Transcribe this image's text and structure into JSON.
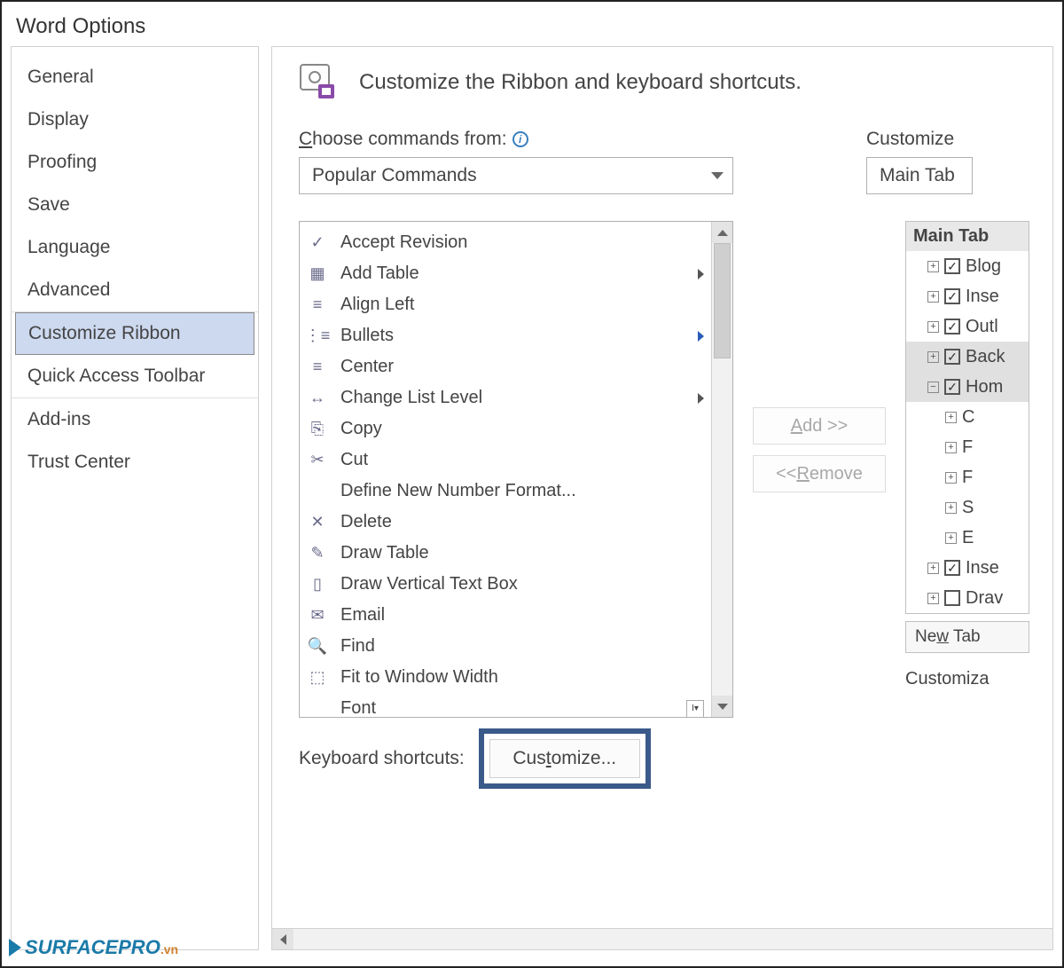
{
  "title": "Word Options",
  "sidebar": {
    "items": [
      {
        "label": "General"
      },
      {
        "label": "Display"
      },
      {
        "label": "Proofing"
      },
      {
        "label": "Save"
      },
      {
        "label": "Language"
      },
      {
        "label": "Advanced"
      },
      {
        "label": "Customize Ribbon"
      },
      {
        "label": "Quick Access Toolbar"
      },
      {
        "label": "Add-ins"
      },
      {
        "label": "Trust Center"
      }
    ]
  },
  "header": {
    "text": "Customize the Ribbon and keyboard shortcuts."
  },
  "choose_label": "Choose commands from:",
  "choose_value": "Popular Commands",
  "customize_ribbon_label": "Customize",
  "customize_ribbon_value": "Main Tab",
  "commands": [
    {
      "label": "Accept Revision",
      "icon": "✓",
      "sub": false
    },
    {
      "label": "Add Table",
      "icon": "▦",
      "sub": true
    },
    {
      "label": "Align Left",
      "icon": "≡",
      "sub": false
    },
    {
      "label": "Bullets",
      "icon": "⋮≡",
      "sub": true,
      "blue": true
    },
    {
      "label": "Center",
      "icon": "≡",
      "sub": false
    },
    {
      "label": "Change List Level",
      "icon": "↔",
      "sub": true
    },
    {
      "label": "Copy",
      "icon": "⎘",
      "sub": false
    },
    {
      "label": "Cut",
      "icon": "✂",
      "sub": false
    },
    {
      "label": "Define New Number Format...",
      "icon": "",
      "sub": false
    },
    {
      "label": "Delete",
      "icon": "✕",
      "sub": false
    },
    {
      "label": "Draw Table",
      "icon": "✎",
      "sub": false
    },
    {
      "label": "Draw Vertical Text Box",
      "icon": "▯",
      "sub": false
    },
    {
      "label": "Email",
      "icon": "✉",
      "sub": false
    },
    {
      "label": "Find",
      "icon": "🔍",
      "sub": false
    },
    {
      "label": "Fit to Window Width",
      "icon": "⬚",
      "sub": false
    },
    {
      "label": "Font",
      "icon": "",
      "sub": false,
      "drop": true
    }
  ],
  "tree_header": "Main Tab",
  "tree": [
    {
      "label": "Blog",
      "checked": true,
      "exp": "+",
      "indent": 1
    },
    {
      "label": "Inse",
      "checked": true,
      "exp": "+",
      "indent": 1
    },
    {
      "label": "Outl",
      "checked": true,
      "exp": "+",
      "indent": 1
    },
    {
      "label": "Back",
      "checked": true,
      "exp": "+",
      "indent": 1,
      "sel": true
    },
    {
      "label": "Hom",
      "checked": true,
      "exp": "−",
      "indent": 1,
      "sel": true
    },
    {
      "label": "C",
      "exp": "+",
      "indent": 2
    },
    {
      "label": "F",
      "exp": "+",
      "indent": 2
    },
    {
      "label": "F",
      "exp": "+",
      "indent": 2
    },
    {
      "label": "S",
      "exp": "+",
      "indent": 2
    },
    {
      "label": "E",
      "exp": "+",
      "indent": 2
    },
    {
      "label": "Inse",
      "checked": true,
      "exp": "+",
      "indent": 1
    },
    {
      "label": "Drav",
      "checked": false,
      "exp": "+",
      "indent": 1
    }
  ],
  "new_tab_label": "New Tab",
  "customizations_label": "Customiza",
  "add_label": "Add >>",
  "remove_label": "<< Remove",
  "kb_label": "Keyboard shortcuts:",
  "customize_btn": "Customize...",
  "logo_text": "URFACEPRO",
  "logo_vn": ".vn"
}
